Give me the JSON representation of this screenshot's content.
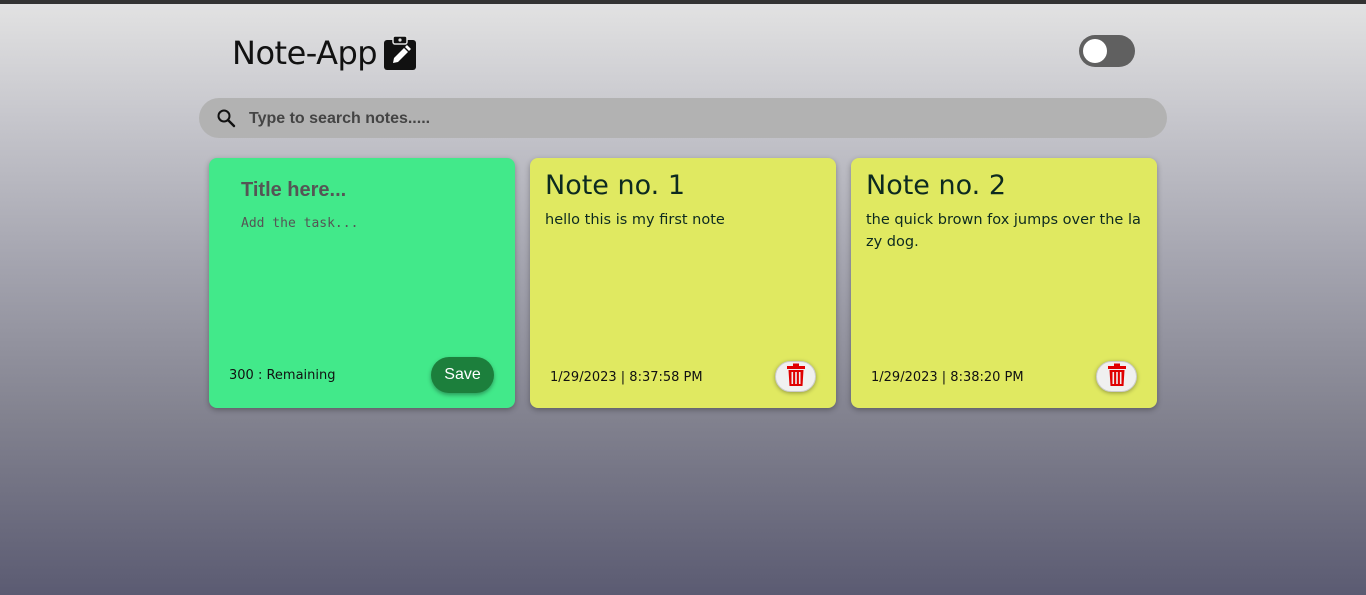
{
  "app": {
    "title": "Note-App",
    "title_icon": "clipboard-pencil-icon"
  },
  "theme_toggle": {
    "state": "off"
  },
  "search": {
    "placeholder": "Type to search notes.....",
    "icon": "search-icon"
  },
  "new_note": {
    "title_placeholder": "Title here...",
    "body_placeholder": "Add the task...",
    "remaining_text": "300 : Remaining",
    "save_label": "Save",
    "color": "#42e98a"
  },
  "notes": [
    {
      "title": "Note no. 1",
      "body": "hello this is my first note",
      "date": "1/29/2023 | 8:37:58 PM",
      "delete_icon": "trash-icon"
    },
    {
      "title": "Note no. 2",
      "body": "the quick brown fox jumps over the lazy dog.",
      "date": "1/29/2023 | 8:38:20 PM",
      "delete_icon": "trash-icon"
    }
  ],
  "colors": {
    "note_yellow": "#e0e961",
    "save_green": "#1c7f3c",
    "delete_red": "#e00000"
  }
}
